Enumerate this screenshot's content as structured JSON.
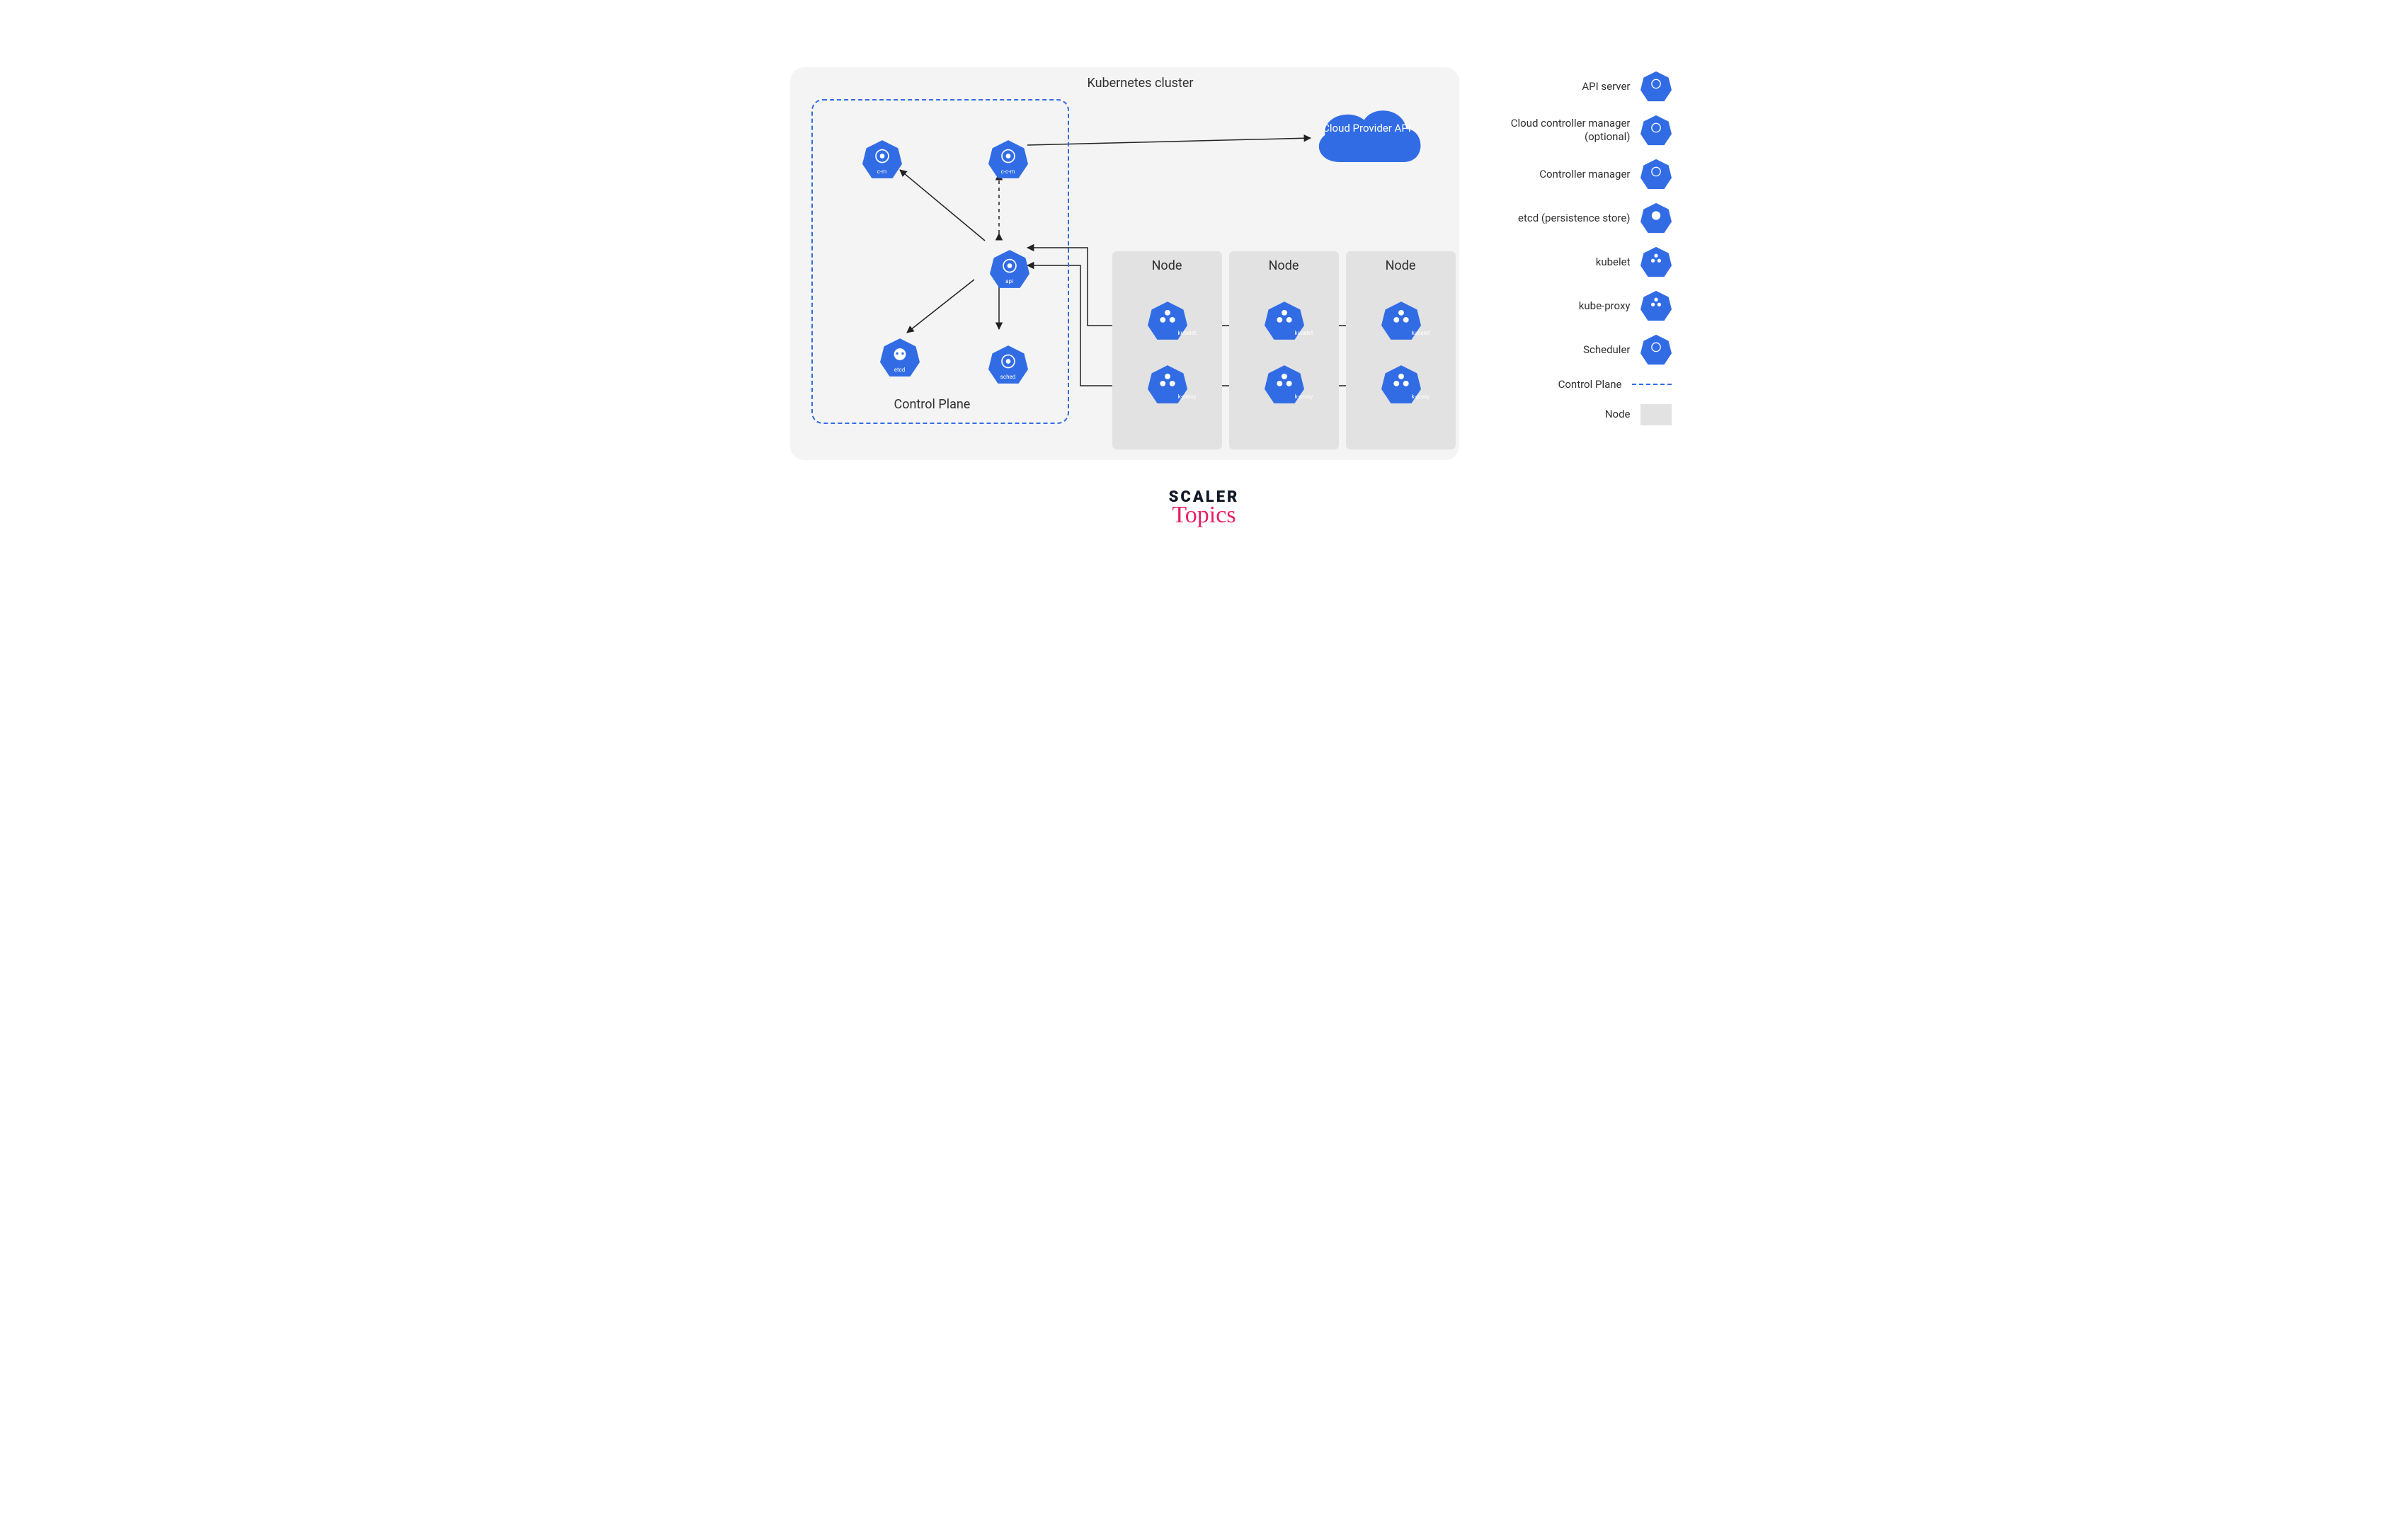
{
  "title": "Kubernetes cluster",
  "control_plane_label": "Control Plane",
  "node_label": "Node",
  "cloud_label": "Cloud Provider API",
  "components": {
    "cm": "c-m",
    "ccm": "c-c-m",
    "api": "api",
    "etcd": "etcd",
    "sched": "sched",
    "kubelet": "kubelet",
    "kproxy": "k-proxy"
  },
  "legend": [
    {
      "label": "API server",
      "icon": "api"
    },
    {
      "label": "Cloud controller manager (optional)",
      "icon": "c-c-m"
    },
    {
      "label": "Controller manager",
      "icon": "c-m"
    },
    {
      "label": "etcd (persistence store)",
      "icon": "etcd"
    },
    {
      "label": "kubelet",
      "icon": "kubelet"
    },
    {
      "label": "kube-proxy",
      "icon": "k-proxy"
    },
    {
      "label": "Scheduler",
      "icon": "sched"
    }
  ],
  "legend_cp": "Control Plane",
  "legend_node": "Node",
  "brand": {
    "line1": "SCALER",
    "line2": "Topics"
  }
}
